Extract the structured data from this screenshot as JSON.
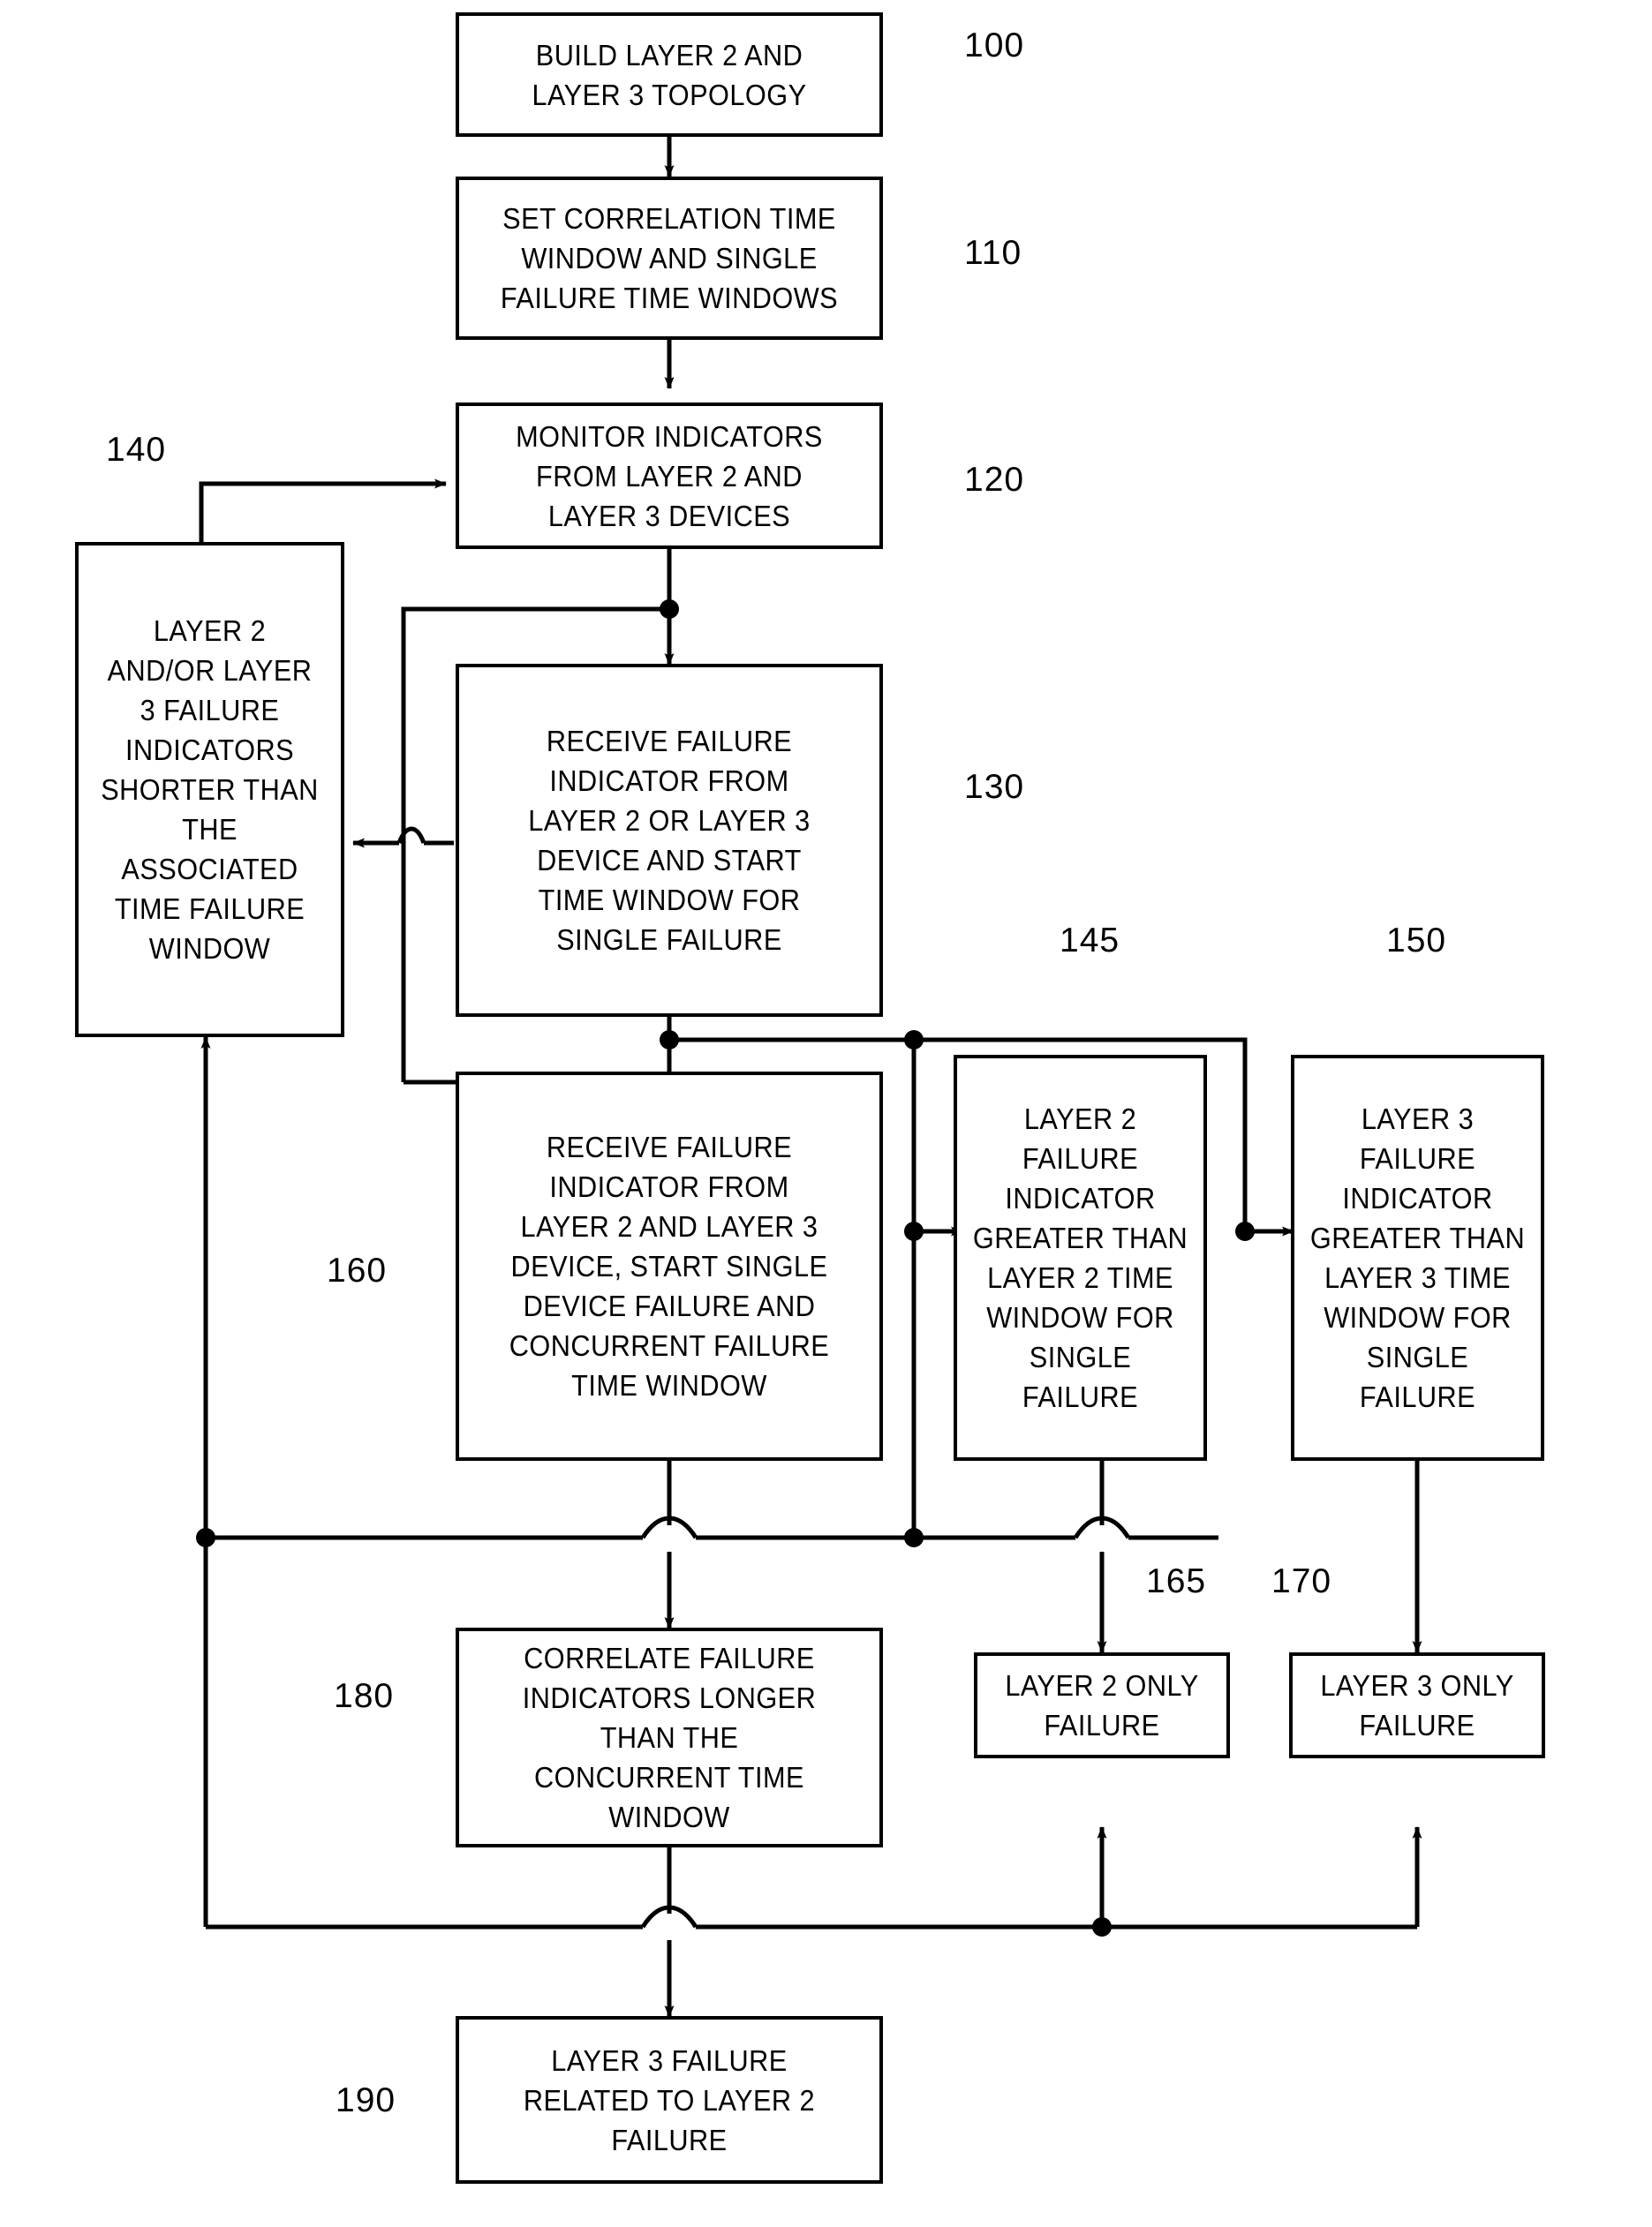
{
  "figure": {
    "type": "patent-flowchart",
    "title": "Layer 2 / Layer 3 failure correlation flowchart"
  },
  "nodes": [
    {
      "id": "n100",
      "ref": "100",
      "text": "BUILD LAYER 2 AND\nLAYER 3 TOPOLOGY"
    },
    {
      "id": "n110",
      "ref": "110",
      "text": "SET CORRELATION TIME\nWINDOW AND SINGLE\nFAILURE TIME WINDOWS"
    },
    {
      "id": "n120",
      "ref": "120",
      "text": "MONITOR INDICATORS\nFROM LAYER 2 AND\nLAYER 3 DEVICES"
    },
    {
      "id": "n130",
      "ref": "130",
      "text": "RECEIVE FAILURE\nINDICATOR FROM\nLAYER 2 OR LAYER 3\nDEVICE AND START\nTIME WINDOW FOR\nSINGLE FAILURE"
    },
    {
      "id": "n140",
      "ref": "140",
      "text": "LAYER 2\nAND/OR LAYER\n3 FAILURE\nINDICATORS\nSHORTER THAN\nTHE\nASSOCIATED\nTIME FAILURE\nWINDOW"
    },
    {
      "id": "n160",
      "ref": "160",
      "text": "RECEIVE FAILURE\nINDICATOR FROM\nLAYER 2 AND LAYER 3\nDEVICE, START SINGLE\nDEVICE FAILURE AND\nCONCURRENT FAILURE\nTIME WINDOW"
    },
    {
      "id": "n145",
      "ref": "145",
      "text": "LAYER 2\nFAILURE\nINDICATOR\nGREATER THAN\nLAYER 2 TIME\nWINDOW FOR\nSINGLE\nFAILURE"
    },
    {
      "id": "n150",
      "ref": "150",
      "text": "LAYER 3\nFAILURE\nINDICATOR\nGREATER THAN\nLAYER 3 TIME\nWINDOW FOR\nSINGLE\nFAILURE"
    },
    {
      "id": "n180",
      "ref": "180",
      "text": "CORRELATE FAILURE\nINDICATORS LONGER\nTHAN THE\nCONCURRENT TIME\nWINDOW"
    },
    {
      "id": "n165",
      "ref": "165",
      "text": "LAYER 2 ONLY\nFAILURE"
    },
    {
      "id": "n170",
      "ref": "170",
      "text": "LAYER 3 ONLY\nFAILURE"
    },
    {
      "id": "n190",
      "ref": "190",
      "text": "LAYER 3 FAILURE\nRELATED TO LAYER 2\nFAILURE"
    }
  ],
  "colors": {
    "line": "#000000",
    "background": "#ffffff"
  }
}
